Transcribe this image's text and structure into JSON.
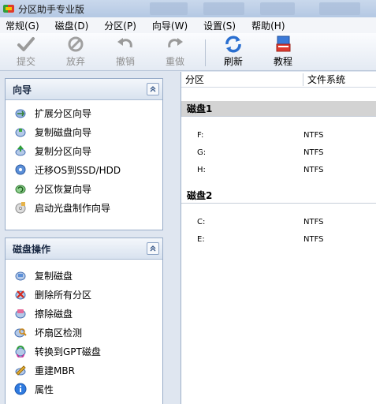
{
  "window": {
    "title": "分区助手专业版"
  },
  "menu": [
    "常规(G)",
    "磁盘(D)",
    "分区(P)",
    "向导(W)",
    "设置(S)",
    "帮助(H)"
  ],
  "toolbar": {
    "commit": "提交",
    "discard": "放弃",
    "undo": "撤销",
    "redo": "重做",
    "refresh": "刷新",
    "tutorial": "教程"
  },
  "wizard_panel": {
    "title": "向导",
    "items": [
      "扩展分区向导",
      "复制磁盘向导",
      "复制分区向导",
      "迁移OS到SSD/HDD",
      "分区恢复向导",
      "启动光盘制作向导"
    ]
  },
  "disk_panel": {
    "title": "磁盘操作",
    "items": [
      "复制磁盘",
      "删除所有分区",
      "擦除磁盘",
      "坏扇区检测",
      "转换到GPT磁盘",
      "重建MBR",
      "属性"
    ]
  },
  "table": {
    "col_partition": "分区",
    "col_filesystem": "文件系统",
    "disks": [
      {
        "name": "磁盘1",
        "partitions": [
          {
            "name": "F:",
            "fs": "NTFS"
          },
          {
            "name": "G:",
            "fs": "NTFS"
          },
          {
            "name": "H:",
            "fs": "NTFS"
          }
        ]
      },
      {
        "name": "磁盘2",
        "partitions": [
          {
            "name": "C:",
            "fs": "NTFS"
          },
          {
            "name": "E:",
            "fs": "NTFS"
          }
        ]
      }
    ]
  }
}
